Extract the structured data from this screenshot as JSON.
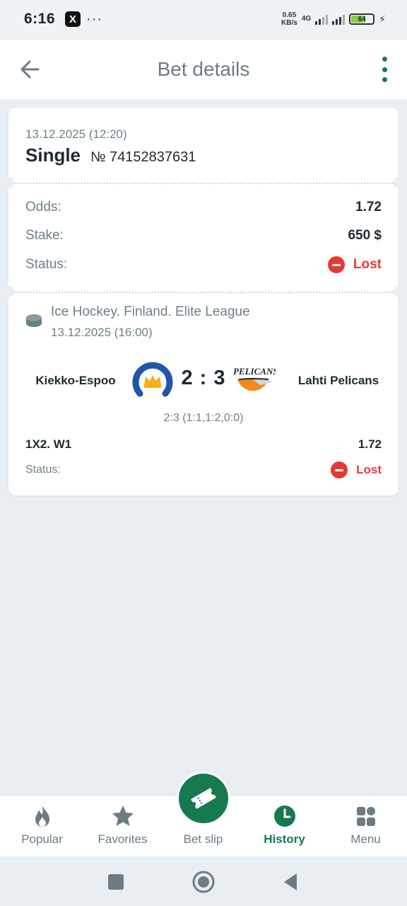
{
  "status_bar": {
    "time": "6:16",
    "app_icon": "X",
    "more": "···",
    "speed_value": "0.65",
    "speed_unit": "KB/s",
    "network": "4G",
    "battery": "64"
  },
  "header": {
    "title": "Bet details",
    "back_icon": "arrow-left-icon",
    "more_icon": "vertical-dots-icon"
  },
  "bet": {
    "date": "13.12.2025 (12:20)",
    "type": "Single",
    "number": "№ 74152837631",
    "odds_label": "Odds:",
    "odds_value": "1.72",
    "stake_label": "Stake:",
    "stake_value": "650 $",
    "status_label": "Status:",
    "status_value": "Lost"
  },
  "event": {
    "league": "Ice Hockey. Finland. Elite League",
    "date": "13.12.2025 (16:00)",
    "home_team": "Kiekko-Espoo",
    "away_team": "Lahti Pelicans",
    "away_logo_text": "PELICANS",
    "score": "2 : 3",
    "period_score": "2:3 (1:1,1:2,0:0)",
    "market": "1X2. W1",
    "market_odds": "1.72",
    "status_label": "Status:",
    "status_value": "Lost"
  },
  "bottom_nav": {
    "items": [
      {
        "label": "Popular",
        "icon": "flame-icon"
      },
      {
        "label": "Favorites",
        "icon": "star-icon"
      },
      {
        "label": "Bet slip",
        "icon": "ticket-icon"
      },
      {
        "label": "History",
        "icon": "clock-icon"
      },
      {
        "label": "Menu",
        "icon": "grid-icon"
      }
    ],
    "active": "History"
  },
  "colors": {
    "accent": "#177a4f",
    "lost": "#e53935",
    "background": "#e9eef2"
  }
}
